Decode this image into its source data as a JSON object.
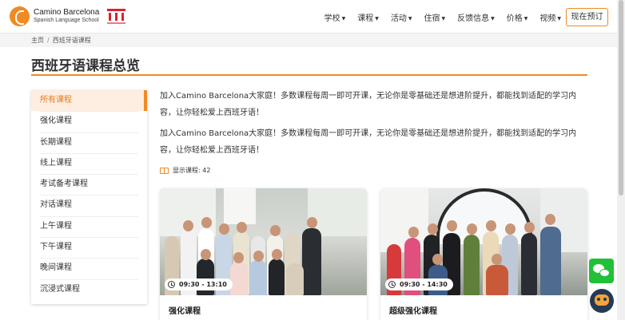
{
  "brand": {
    "name": "Camino Barcelona",
    "subtitle": "Spanish Language School",
    "accent": "#f08a24"
  },
  "nav": {
    "items": [
      {
        "label": "学校"
      },
      {
        "label": "课程"
      },
      {
        "label": "活动"
      },
      {
        "label": "住宿"
      },
      {
        "label": "反馈信息"
      },
      {
        "label": "价格"
      },
      {
        "label": "视频"
      }
    ],
    "book_button": "现在预订"
  },
  "breadcrumb": {
    "home": "主页",
    "separator": "/",
    "current": "西班牙语课程"
  },
  "page": {
    "title": "西班牙语课程总览",
    "intro_1": "加入Camino Barcelona大家庭！多数课程每周一即可开课，无论你是零基础还是想进阶提升，都能找到适配的学习内容，让你轻松爱上西班牙语！",
    "intro_2": "加入Camino Barcelona大家庭！多数课程每周一即可开课，无论你是零基础还是想进阶提升，都能找到适配的学习内容，让你轻松爱上西班牙语！",
    "course_count": "显示课程: 42"
  },
  "sidebar": {
    "items": [
      {
        "label": "所有课程",
        "active": true
      },
      {
        "label": "强化课程"
      },
      {
        "label": "长期课程"
      },
      {
        "label": "线上课程"
      },
      {
        "label": "考试备考课程"
      },
      {
        "label": "对话课程"
      },
      {
        "label": "上午课程"
      },
      {
        "label": "下午课程"
      },
      {
        "label": "晚间课程"
      },
      {
        "label": "沉浸式课程"
      }
    ]
  },
  "courses": [
    {
      "time": "09:30 - 13:10",
      "title": "强化课程"
    },
    {
      "time": "09:30 - 14:30",
      "title": "超级强化课程"
    }
  ],
  "widgets": {
    "wechat_color": "#21c038",
    "bot_color": "#243a55"
  }
}
